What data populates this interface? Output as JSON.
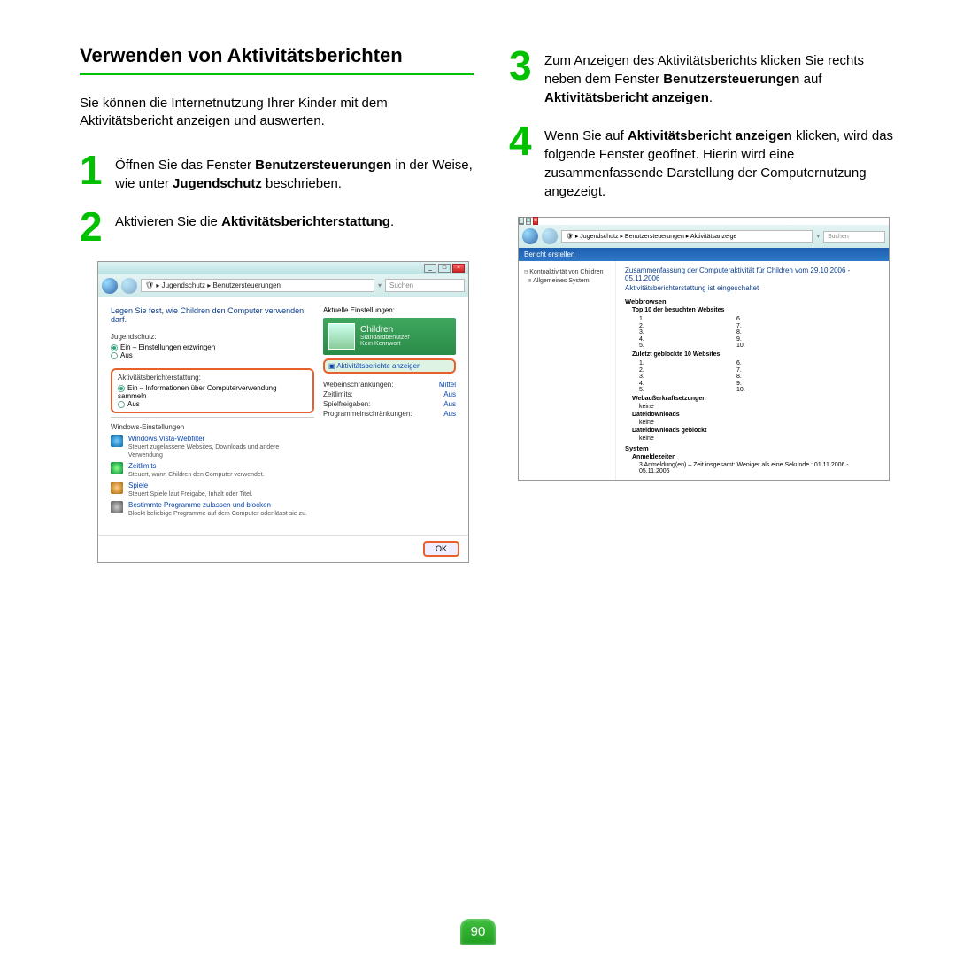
{
  "heading": "Verwenden von Aktivitätsberichten",
  "intro": "Sie können die Internetnutzung Ihrer Kinder mit dem Aktivitätsbericht anzeigen und auswerten.",
  "steps": {
    "s1": {
      "pre": "Öffnen Sie das Fenster ",
      "b1": "Benutzersteuerungen",
      "mid": " in der Weise, wie unter ",
      "b2": "Jugendschutz",
      "post": " beschrieben."
    },
    "s2": {
      "pre": "Aktivieren Sie die ",
      "b1": "Aktivitätsberichterstattung",
      "post": "."
    },
    "s3": {
      "pre": "Zum Anzeigen des Aktivitätsberichts klicken Sie rechts neben dem Fenster ",
      "b1": "Benutzersteuerungen",
      "mid": " auf ",
      "b2": "Aktivitätsbericht anzeigen",
      "post": "."
    },
    "s4": {
      "pre": "Wenn Sie auf ",
      "b1": "Aktivitätsbericht anzeigen",
      "post": " klicken, wird das folgende Fenster geöffnet. Hierin wird eine zusammenfassende Darstellung der Computernutzung angezeigt."
    }
  },
  "shot1": {
    "crumb_parts": [
      "Jugendschutz",
      "Benutzersteuerungen"
    ],
    "search": "Suchen",
    "instruction": "Legen Sie fest, wie Children den Computer verwenden darf.",
    "jugend_head": "Jugendschutz:",
    "jugend_on": "Ein – Einstellungen erzwingen",
    "jugend_off": "Aus",
    "akt_head": "Aktivitätsberichterstattung:",
    "akt_on": "Ein – Informationen über Computerverwendung sammeln",
    "akt_off": "Aus",
    "winset_head": "Windows-Einstellungen",
    "ws": [
      {
        "link": "Windows Vista-Webfilter",
        "desc": "Steuert zugelassene Websites, Downloads und andere Verwendung"
      },
      {
        "link": "Zeitlimits",
        "desc": "Steuert, wann Children den Computer verwendet."
      },
      {
        "link": "Spiele",
        "desc": "Steuert Spiele laut Freigabe, Inhalt oder Titel."
      },
      {
        "link": "Bestimmte Programme zulassen und blocken",
        "desc": "Blockt beliebige Programme auf dem Computer oder lässt sie zu."
      }
    ],
    "right_head": "Aktuelle Einstellungen:",
    "username": "Children",
    "usersub1": "Standardbenutzer",
    "usersub2": "Kein Kennwort",
    "viewreport": "Aktivitätsberichte anzeigen",
    "settings": [
      {
        "label": "Webeinschränkungen:",
        "val": "Mittel"
      },
      {
        "label": "Zeitlimits:",
        "val": "Aus"
      },
      {
        "label": "Spielfreigaben:",
        "val": "Aus"
      },
      {
        "label": "Programmeinschränkungen:",
        "val": "Aus"
      }
    ],
    "ok": "OK"
  },
  "shot2": {
    "crumb_parts": [
      "Jugendschutz",
      "Benutzersteuerungen",
      "Aktivitätsanzeige"
    ],
    "search": "Suchen",
    "bluebar": "Bericht erstellen",
    "tree_sel": "Kontoaktivität von Children",
    "tree_item": "Allgemeines System",
    "summary": "Zusammenfassung der Computeraktivität für Children vom 29.10.2006 - 05.11.2006",
    "on": "Aktivitätsberichterstattung ist eingeschaltet",
    "cat_web": "Webbrowsen",
    "sub_top10": "Top 10 der besuchten Websites",
    "sub_blocked": "Zuletzt geblockte 10 Websites",
    "sub_override": "Webaußerkraftsetzungen",
    "none": "keine",
    "sub_dl": "Dateidownloads",
    "sub_dlblock": "Dateidownloads geblockt",
    "cat_sys": "System",
    "sub_login": "Anmeldezeiten",
    "login_detail": "3 Anmeldung(en) – Zeit insgesamt: Weniger als eine Sekunde : 01.11.2006 - 05.11.2006",
    "nums_a": [
      "1.",
      "2.",
      "3.",
      "4.",
      "5."
    ],
    "nums_b": [
      "6.",
      "7.",
      "8.",
      "9.",
      "10."
    ]
  },
  "pagenum": "90"
}
